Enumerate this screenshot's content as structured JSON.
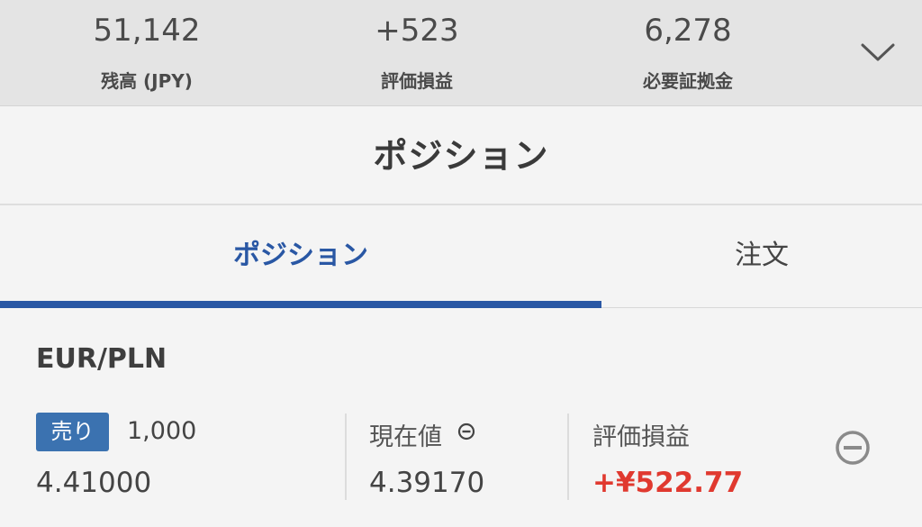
{
  "summary": {
    "balance": {
      "value": "51,142",
      "label": "残高 (JPY)"
    },
    "unrealized_pl": {
      "value": "+523",
      "label": "評価損益"
    },
    "margin": {
      "value": "6,278",
      "label": "必要証拠金"
    },
    "expand_icon": "chevron-down-icon"
  },
  "page": {
    "title": "ポジション"
  },
  "tabs": [
    {
      "label": "ポジション",
      "active": true
    },
    {
      "label": "注文",
      "active": false
    }
  ],
  "accent_color": "#2957a4",
  "position": {
    "pair": "EUR/PLN",
    "side": "売り",
    "side_color": "#3b72b0",
    "quantity": "1,000",
    "open_price": "4.41000",
    "current_label": "現在値",
    "current_price": "4.39170",
    "pl_label": "評価損益",
    "pl_value": "+¥522.77",
    "pl_color": "#e0392f",
    "close_icon": "minus-circle-icon"
  }
}
